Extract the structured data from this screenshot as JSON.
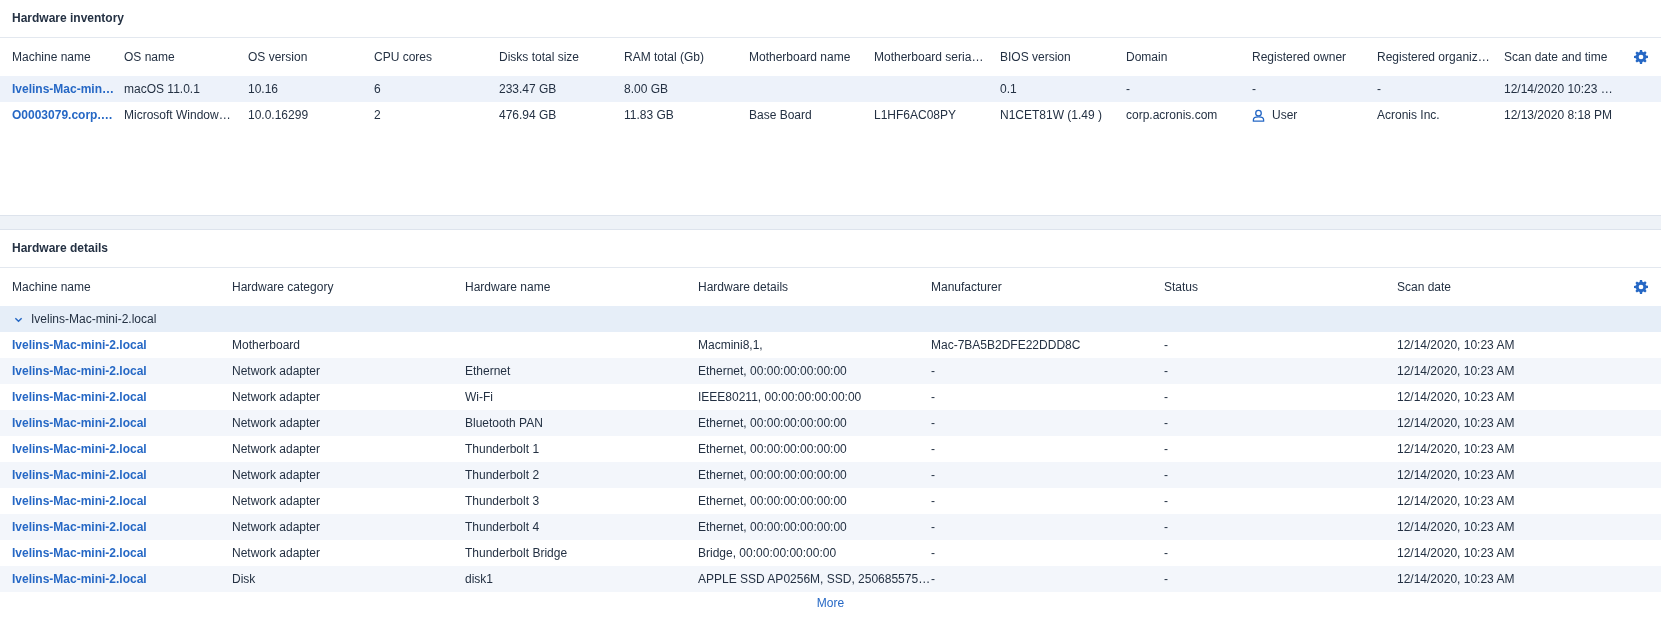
{
  "inventory": {
    "title": "Hardware inventory",
    "columns": [
      "Machine name",
      "OS name",
      "OS version",
      "CPU cores",
      "Disks total size",
      "RAM total (Gb)",
      "Motherboard name",
      "Motherboard seria…",
      "BIOS version",
      "Domain",
      "Registered owner",
      "Registered organiz…",
      "Scan date and time"
    ],
    "rows": [
      [
        "Ivelins-Mac-min…",
        "macOS 11.0.1",
        "10.16",
        "6",
        "233.47 GB",
        "8.00 GB",
        "",
        "",
        "0.1",
        "-",
        "-",
        "-",
        "12/14/2020 10:23 …"
      ],
      [
        "O0003079.corp.…",
        "Microsoft Window…",
        "10.0.16299",
        "2",
        "476.94 GB",
        "11.83 GB",
        "Base Board",
        "L1HF6AC08PY",
        "N1CET81W (1.49 )",
        "corp.acronis.com",
        {
          "kind": "user",
          "text": "User"
        },
        "Acronis Inc.",
        "12/13/2020 8:18 PM"
      ]
    ]
  },
  "details": {
    "title": "Hardware details",
    "columns": [
      "Machine name",
      "Hardware category",
      "Hardware name",
      "Hardware details",
      "Manufacturer",
      "Status",
      "Scan date"
    ],
    "groups": [
      {
        "name": "Ivelins-Mac-mini-2.local",
        "expanded": true,
        "rows": [
          [
            "Ivelins-Mac-mini-2.local",
            "Motherboard",
            "",
            "Macmini8,1,",
            "Mac-7BA5B2DFE22DDD8C",
            "-",
            "12/14/2020, 10:23 AM"
          ],
          [
            "Ivelins-Mac-mini-2.local",
            "Network adapter",
            "Ethernet",
            "Ethernet, 00:00:00:00:00:00",
            "-",
            "-",
            "12/14/2020, 10:23 AM"
          ],
          [
            "Ivelins-Mac-mini-2.local",
            "Network adapter",
            "Wi-Fi",
            "IEEE80211, 00:00:00:00:00:00",
            "-",
            "-",
            "12/14/2020, 10:23 AM"
          ],
          [
            "Ivelins-Mac-mini-2.local",
            "Network adapter",
            "Bluetooth PAN",
            "Ethernet, 00:00:00:00:00:00",
            "-",
            "-",
            "12/14/2020, 10:23 AM"
          ],
          [
            "Ivelins-Mac-mini-2.local",
            "Network adapter",
            "Thunderbolt 1",
            "Ethernet, 00:00:00:00:00:00",
            "-",
            "-",
            "12/14/2020, 10:23 AM"
          ],
          [
            "Ivelins-Mac-mini-2.local",
            "Network adapter",
            "Thunderbolt 2",
            "Ethernet, 00:00:00:00:00:00",
            "-",
            "-",
            "12/14/2020, 10:23 AM"
          ],
          [
            "Ivelins-Mac-mini-2.local",
            "Network adapter",
            "Thunderbolt 3",
            "Ethernet, 00:00:00:00:00:00",
            "-",
            "-",
            "12/14/2020, 10:23 AM"
          ],
          [
            "Ivelins-Mac-mini-2.local",
            "Network adapter",
            "Thunderbolt 4",
            "Ethernet, 00:00:00:00:00:00",
            "-",
            "-",
            "12/14/2020, 10:23 AM"
          ],
          [
            "Ivelins-Mac-mini-2.local",
            "Network adapter",
            "Thunderbolt Bridge",
            "Bridge, 00:00:00:00:00:00",
            "-",
            "-",
            "12/14/2020, 10:23 AM"
          ],
          [
            "Ivelins-Mac-mini-2.local",
            "Disk",
            "disk1",
            "APPLE SSD AP0256M, SSD, 250685575…",
            "-",
            "-",
            "12/14/2020, 10:23 AM"
          ]
        ]
      }
    ],
    "more": "More"
  }
}
